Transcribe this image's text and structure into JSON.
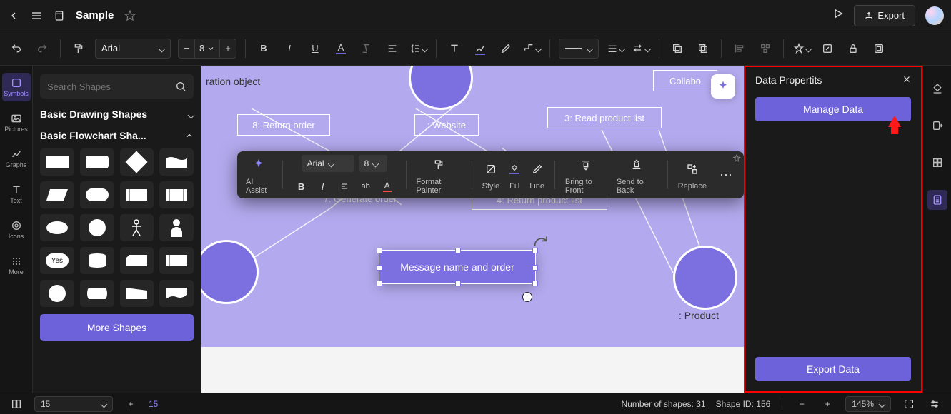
{
  "titlebar": {
    "doc_title": "Sample",
    "export_label": "Export"
  },
  "toolbar": {
    "font": "Arial",
    "font_size": "8"
  },
  "leftrail": {
    "symbols": "Symbols",
    "pictures": "Pictures",
    "graphs": "Graphs",
    "text": "Text",
    "icons": "Icons",
    "more": "More"
  },
  "sidepanel": {
    "search_placeholder": "Search Shapes",
    "section_basic_drawing": "Basic Drawing Shapes",
    "section_basic_flowchart": "Basic Flowchart Sha...",
    "yes_label": "Yes",
    "more_shapes": "More Shapes"
  },
  "canvas": {
    "box_collab_object": "ration object",
    "box_return_order": "8: Return order",
    "box_website": ": Website",
    "box_read_product": "3: Read product list",
    "box_generate_order": "7: Generate order",
    "box_return_product": "4: Return product list",
    "box_collab_right": "Collabo",
    "box_product": ": Product",
    "sel_shape_text": "Message name and order"
  },
  "floatbar": {
    "ai_assist": "AI Assist",
    "font": "Arial",
    "size": "8",
    "format_painter": "Format Painter",
    "style": "Style",
    "fill": "Fill",
    "line": "Line",
    "bring_front": "Bring to Front",
    "send_back": "Send to Back",
    "replace": "Replace"
  },
  "rightpanel": {
    "title": "Data Propertits",
    "manage_data": "Manage Data",
    "export_data": "Export Data"
  },
  "statusbar": {
    "page_val": "15",
    "page_num": "15",
    "shape_count_label": "Number of shapes: ",
    "shape_count": "31",
    "shape_id_label": "Shape ID: ",
    "shape_id": "156",
    "zoom": "145%"
  }
}
